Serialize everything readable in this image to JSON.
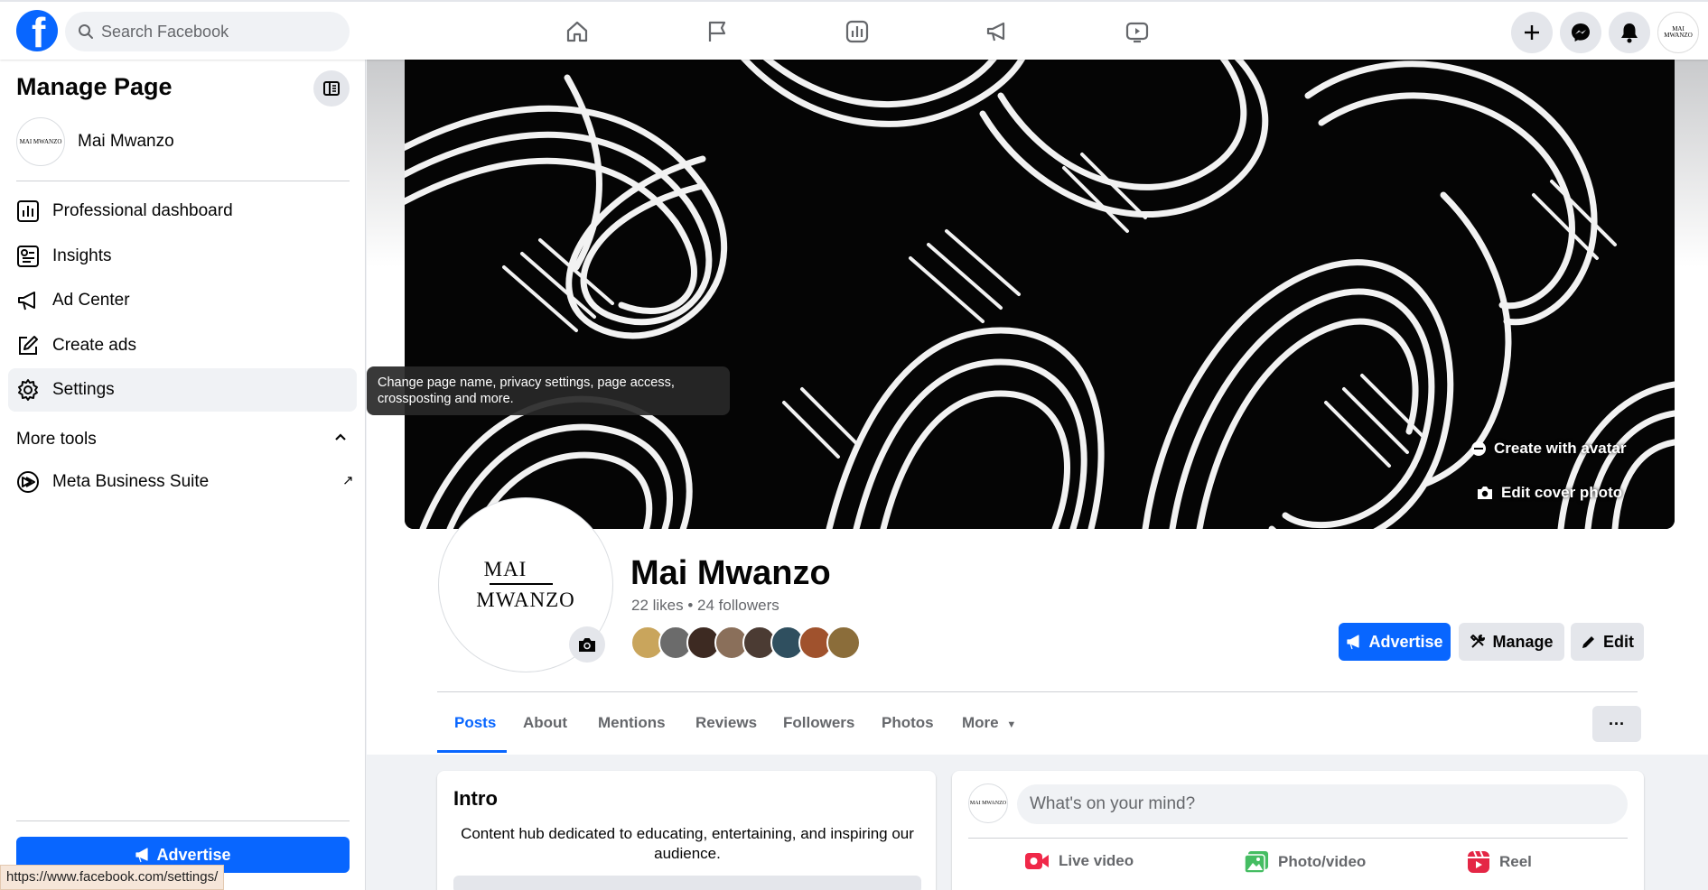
{
  "topbar": {
    "logo": "f",
    "search_placeholder": "Search Facebook",
    "nav_icons": [
      "home-icon",
      "flag-icon",
      "insights-icon",
      "megaphone-icon",
      "video-icon"
    ],
    "actions": [
      "plus-icon",
      "messenger-icon",
      "bell-icon"
    ],
    "avatar_text": "MAI MWANZO"
  },
  "sidebar": {
    "title": "Manage Page",
    "page_name": "Mai Mwanzo",
    "page_avatar_text": "MAI MWANZO",
    "items": [
      {
        "label": "Professional dashboard",
        "icon": "dashboard-icon"
      },
      {
        "label": "Insights",
        "icon": "insights-icon"
      },
      {
        "label": "Ad Center",
        "icon": "megaphone-icon"
      },
      {
        "label": "Create ads",
        "icon": "edit-icon"
      },
      {
        "label": "Settings",
        "icon": "gear-icon"
      }
    ],
    "more_tools_label": "More tools",
    "meta_business_suite": "Meta Business Suite",
    "external_arrow": "↗",
    "advertise_label": "Advertise"
  },
  "tooltip": {
    "text": "Change page name, privacy settings, page access, crossposting and more."
  },
  "status_bar": {
    "url": "https://www.facebook.com/settings/"
  },
  "cover": {
    "create_avatar_label": "Create with avatar",
    "edit_cover_label": "Edit cover photo"
  },
  "profile": {
    "logo_line1": "MAI",
    "logo_line2": "MWANZO",
    "name": "Mai Mwanzo",
    "stats": "22 likes • 24 followers",
    "follower_colors": [
      "#c9a55c",
      "#6b6b6b",
      "#3d2a22",
      "#8a6f5a",
      "#4b3b33",
      "#2f4f5f",
      "#a0522d",
      "#8b6d3a"
    ]
  },
  "actions": {
    "advertise": "Advertise",
    "manage": "Manage",
    "edit": "Edit",
    "more": "···"
  },
  "tabs": [
    "Posts",
    "About",
    "Mentions",
    "Reviews",
    "Followers",
    "Photos",
    "More"
  ],
  "intro": {
    "title": "Intro",
    "text": "Content hub dedicated to educating, entertaining, and inspiring our audience."
  },
  "composer": {
    "placeholder": "What's on your mind?",
    "live_video": "Live video",
    "photo_video": "Photo/video",
    "reel": "Reel"
  },
  "colors": {
    "brand_blue": "#0866ff",
    "live_red": "#f02849",
    "photo_green": "#45bd62",
    "reel_pink": "#e42645"
  }
}
